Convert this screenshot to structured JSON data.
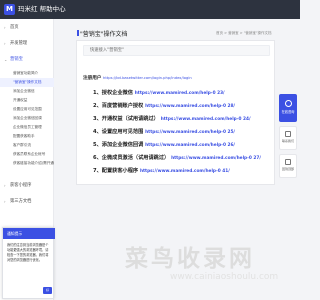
{
  "app": {
    "logo_letter": "M",
    "title": "玛米红 帮助中心"
  },
  "sidebar": {
    "items": [
      {
        "label": "首页",
        "chevron": "›"
      },
      {
        "label": "开发管理",
        "chevron": "›"
      },
      {
        "label": "营销宝",
        "chevron": "⌄"
      },
      {
        "label": "获客小程序",
        "chevron": "›"
      },
      {
        "label": "第三方文档",
        "chevron": "›"
      }
    ],
    "sub_items": [
      "营销宝功能简介",
      "\"营销宝\"操作文档",
      "添加企业微信",
      "开通权益",
      "设置应用可见范围",
      "添加企业微信回调",
      "企业微信员工管理",
      "配置获客助手",
      "客户群引流",
      "获客员联系企业帐号",
      "获客链接功能介绍(需开通权益才..."
    ]
  },
  "breadcrumb": "首页 > 营销宝 > \"营销宝\"操作文档",
  "doc": {
    "title": "\"营销宝\"操作文档",
    "intro": "快速接入\"营销宝\"",
    "register_label": "注册用户",
    "register_url": "https://bd.basetwitter.com/login.php/index/login",
    "steps": [
      {
        "label": "1、授权企业微信",
        "url": "https://www.mamired.com/help-0 23/"
      },
      {
        "label": "2、百度营销账户授权",
        "url": "https://www.mamired.com/help-0 28/"
      },
      {
        "label": "3、开通权益（试用请跳过）",
        "url": "https://www.mamired.com/help-0 24/"
      },
      {
        "label": "4、设置应用可见范围",
        "url": "https://www.mamired.com/help-0 25/"
      },
      {
        "label": "5、添加企业微信回调",
        "url": "https://www.mamired.com/help-0 26/"
      },
      {
        "label": "6、企微成员激活（试用请跳过）",
        "url": "https://www.mamired.com/help-0 27/"
      },
      {
        "label": "7、配置获客小程序",
        "url": "https://www.mamired.com/help-0 41/"
      }
    ]
  },
  "float_bar": {
    "primary": "在线咨询",
    "items": [
      "联系我们",
      "回到顶部"
    ]
  },
  "notice": {
    "title": "通知提示",
    "body": "我们的注意到当前浏览器是个功能更强大的浏览器环境，请检查一下您的浏览器，我们将对您的浏览器进行优化。",
    "button": "好"
  },
  "watermark": {
    "text": "菜鸟收录网",
    "site": "www.cainiaoshoulu.com"
  }
}
